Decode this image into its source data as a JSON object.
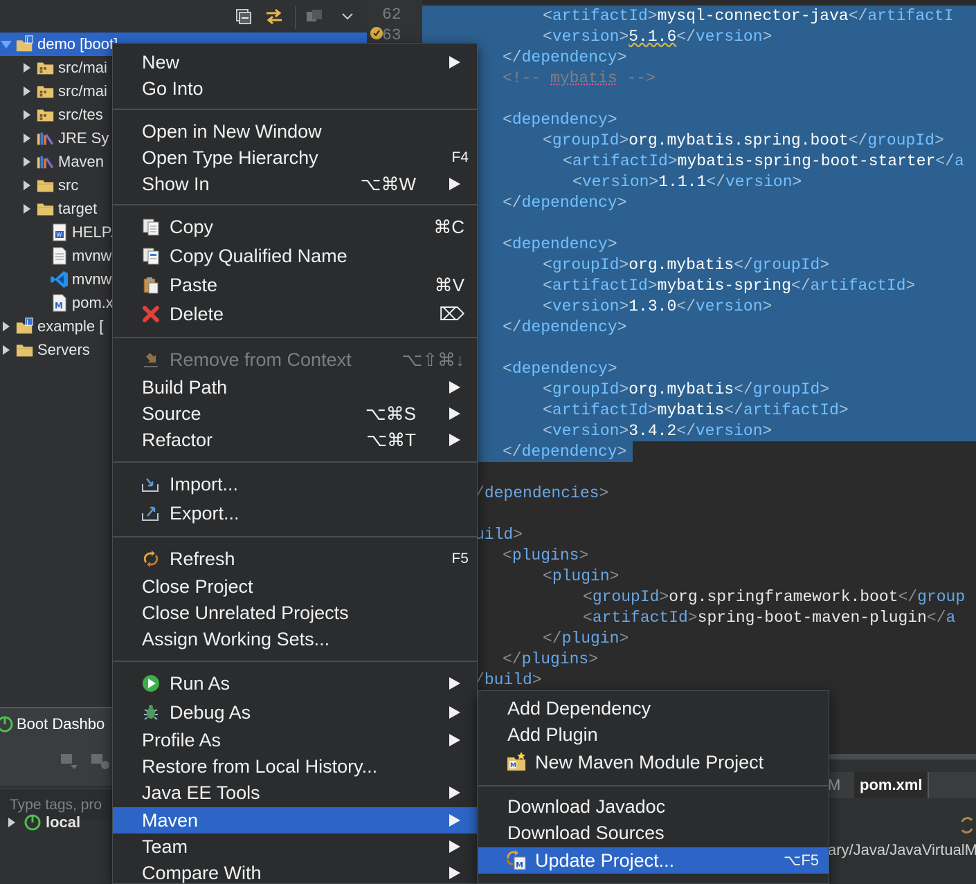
{
  "explorer": {
    "toolbar": {
      "icons": [
        "collapse-all-icon",
        "link-with-editor-icon",
        "focus-icon",
        "view-menu-chevron-icon"
      ]
    },
    "items": [
      {
        "label": "demo [boot]",
        "icon": "maven-boot-project-icon",
        "expanded": true,
        "selected": true
      },
      {
        "label": "src/mai",
        "icon": "source-folder-icon"
      },
      {
        "label": "src/mai",
        "icon": "source-folder-icon"
      },
      {
        "label": "src/tes",
        "icon": "source-folder-icon"
      },
      {
        "label": "JRE Sy",
        "icon": "library-icon"
      },
      {
        "label": "Maven",
        "icon": "library-icon"
      },
      {
        "label": "src",
        "icon": "folder-icon"
      },
      {
        "label": "target",
        "icon": "folder-icon"
      },
      {
        "label": "HELP.m",
        "icon": "markdown-file-icon"
      },
      {
        "label": "mvnw",
        "icon": "file-icon"
      },
      {
        "label": "mvnw.c",
        "icon": "vscode-file-icon"
      },
      {
        "label": "pom.xn",
        "icon": "maven-pom-icon"
      },
      {
        "label": "example [",
        "icon": "maven-boot-project-icon"
      },
      {
        "label": "Servers",
        "icon": "folder-icon"
      }
    ]
  },
  "boot_dashboard": {
    "tab_label": "Boot Dashbo",
    "search_placeholder": "Type tags, pro",
    "local_label": "local"
  },
  "editor": {
    "line_numbers": [
      "62",
      "63"
    ],
    "lines": [
      {
        "tag": "artifactId",
        "text": "mysql-connector-java",
        "close": "artifactI"
      },
      {
        "tag": "version",
        "text": "5.1.6",
        "close": "version"
      },
      {
        "close_only": "dependency"
      },
      {
        "comment_open": "<!-- ",
        "comment_word": "mybatis",
        "comment_close": " -->"
      },
      {
        "open_only": "dependency"
      },
      {
        "tag": "groupId",
        "text": "org.mybatis.spring.boot",
        "close": "groupId"
      },
      {
        "tag": "artifactId",
        "text": "mybatis-spring-boot-starter",
        "close": "a"
      },
      {
        "tag": "version",
        "text": "1.1.1",
        "close": "version"
      },
      {
        "close_only": "dependency"
      },
      {
        "open_only": "dependency"
      },
      {
        "tag": "groupId",
        "text": "org.mybatis",
        "close": "groupId"
      },
      {
        "tag": "artifactId",
        "text": "mybatis-spring",
        "close": "artifactId"
      },
      {
        "tag": "version",
        "text": "1.3.0",
        "close": "version"
      },
      {
        "close_only": "dependency"
      },
      {
        "open_only": "dependency"
      },
      {
        "tag": "groupId",
        "text": "org.mybatis",
        "close": "groupId"
      },
      {
        "tag": "artifactId",
        "text": "mybatis",
        "close": "artifactId"
      },
      {
        "tag": "version",
        "text": "3.4.2",
        "close": "version"
      },
      {
        "close_only": "dependency"
      },
      {
        "partial_close": "dependencies"
      },
      {
        "partial_open": "uild"
      },
      {
        "open_only": "plugins"
      },
      {
        "open_only": "plugin"
      },
      {
        "tag": "groupId",
        "text": "org.springframework.boot",
        "close": "group"
      },
      {
        "tag": "artifactId",
        "text": "spring-boot-maven-plugin",
        "close": "a"
      },
      {
        "close_only": "plugin"
      },
      {
        "close_only": "plugins"
      },
      {
        "partial_close": "build"
      }
    ],
    "bottom_tabs": [
      "M",
      "pom.xml"
    ],
    "path_fragment": "ary/Java/JavaVirtualM"
  },
  "context_menu": {
    "items": [
      {
        "label": "New",
        "submenu": true
      },
      {
        "label": "Go Into"
      },
      {
        "label": "Open in New Window"
      },
      {
        "label": "Open Type Hierarchy",
        "shortcut": "F4"
      },
      {
        "label": "Show In",
        "shortcut": "⌥⌘W",
        "submenu": true
      },
      {
        "label": "Copy",
        "shortcut": "⌘C",
        "icon": "copy-icon"
      },
      {
        "label": "Copy Qualified Name",
        "icon": "copy-qualified-name-icon"
      },
      {
        "label": "Paste",
        "shortcut": "⌘V",
        "icon": "paste-icon"
      },
      {
        "label": "Delete",
        "shortcut": "⌦",
        "icon": "delete-icon"
      },
      {
        "label": "Remove from Context",
        "shortcut": "⌥⇧⌘↓",
        "icon": "remove-context-icon",
        "disabled": true
      },
      {
        "label": "Build Path",
        "submenu": true
      },
      {
        "label": "Source",
        "shortcut": "⌥⌘S",
        "submenu": true
      },
      {
        "label": "Refactor",
        "shortcut": "⌥⌘T",
        "submenu": true
      },
      {
        "label": "Import...",
        "icon": "import-icon"
      },
      {
        "label": "Export...",
        "icon": "export-icon"
      },
      {
        "label": "Refresh",
        "shortcut": "F5",
        "icon": "refresh-icon"
      },
      {
        "label": "Close Project"
      },
      {
        "label": "Close Unrelated Projects"
      },
      {
        "label": "Assign Working Sets..."
      },
      {
        "label": "Run As",
        "submenu": true,
        "icon": "run-icon"
      },
      {
        "label": "Debug As",
        "submenu": true,
        "icon": "debug-icon"
      },
      {
        "label": "Profile As",
        "submenu": true
      },
      {
        "label": "Restore from Local History..."
      },
      {
        "label": "Java EE Tools",
        "submenu": true
      },
      {
        "label": "Maven",
        "submenu": true,
        "highlighted": true
      },
      {
        "label": "Team",
        "submenu": true
      },
      {
        "label": "Compare With",
        "submenu": true
      }
    ]
  },
  "maven_submenu": {
    "items": [
      {
        "label": "Add Dependency"
      },
      {
        "label": "Add Plugin"
      },
      {
        "label": "New Maven Module Project",
        "icon": "new-maven-module-icon"
      },
      {
        "label": "Download Javadoc"
      },
      {
        "label": "Download Sources"
      },
      {
        "label": "Update Project...",
        "shortcut": "⌥F5",
        "icon": "update-project-icon",
        "highlighted": true
      }
    ]
  },
  "colors": {
    "selection": "#2c65c6",
    "menu_bg": "#2a2c2e",
    "editor_selection": "#2c6090",
    "tag": "#6aa7e6"
  }
}
